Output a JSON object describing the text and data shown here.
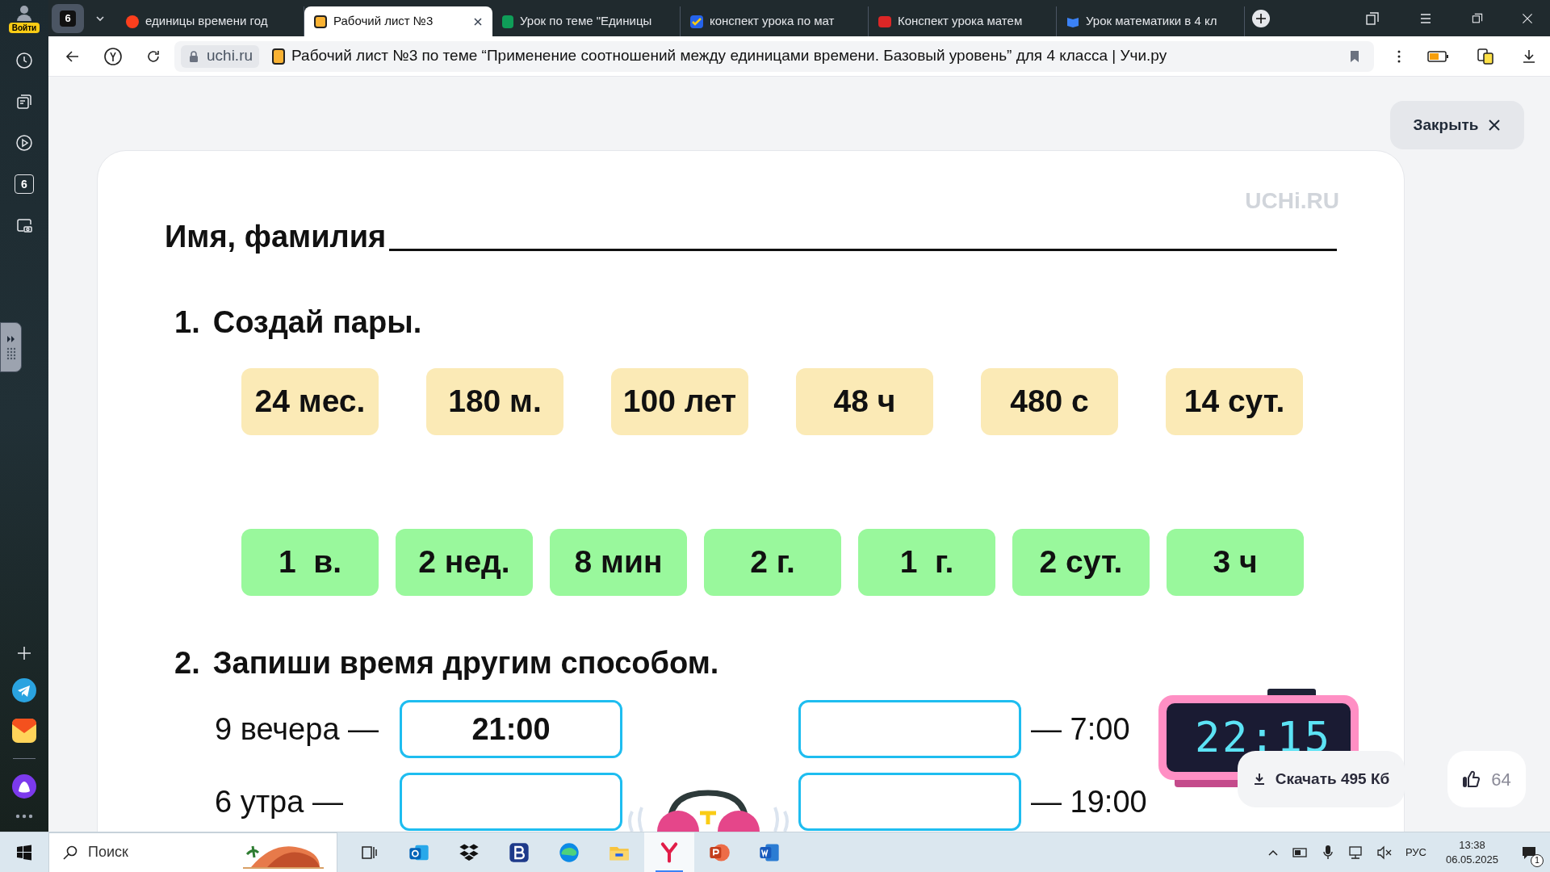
{
  "sidebar": {
    "login_label": "Войти",
    "counter": "6"
  },
  "tab_bar": {
    "tab_count": "6",
    "tabs": [
      {
        "kind": "yandex",
        "title": "единицы времени год",
        "selected": false
      },
      {
        "kind": "uchi",
        "title": "Рабочий лист №3",
        "selected": true
      },
      {
        "kind": "sheets",
        "title": "Урок по теме \"Единицы",
        "selected": false
      },
      {
        "kind": "check",
        "title": "конспект урока по мат",
        "selected": false
      },
      {
        "kind": "presentation",
        "title": "Конспект урока матем",
        "selected": false
      },
      {
        "kind": "book",
        "title": "Урок математики в 4 кл",
        "selected": false
      }
    ]
  },
  "address_bar": {
    "domain": "uchi.ru",
    "page_title": "Рабочий лист №3 по теме “Применение соотношений между единицами времени. Базовый уровень” для 4 класса | Учи.ру"
  },
  "close_button": "Закрыть",
  "worksheet": {
    "brand": "UCHi.RU",
    "name_label": "Имя, фамилия",
    "task1": {
      "number": "1.",
      "title": "Создай пары.",
      "top_cards": [
        "24 мес.",
        "180 м.",
        "100 лет",
        "48 ч",
        "480 с",
        "14 сут."
      ],
      "bottom_cards": [
        "1  в.",
        "2 нед.",
        "8 мин",
        "2 г.",
        "1  г.",
        "2 сут.",
        "3 ч"
      ]
    },
    "task2": {
      "number": "2.",
      "title": "Запиши время другим способом.",
      "rows": [
        {
          "left_label": "9 вечера —",
          "left_value": "21:00",
          "right_label": "— 7:00"
        },
        {
          "left_label": "6 утра —",
          "right_label": "— 19:00"
        }
      ]
    },
    "clock_display": "22:15"
  },
  "download_button": "Скачать 495 Кб",
  "likes": "64",
  "taskbar": {
    "search_placeholder": "Поиск",
    "apps": [
      {
        "kind": "taskview",
        "active": false
      },
      {
        "kind": "outlook",
        "active": false
      },
      {
        "kind": "dropbox",
        "active": false
      },
      {
        "kind": "b",
        "active": false
      },
      {
        "kind": "edge",
        "active": false
      },
      {
        "kind": "explorer",
        "active": false
      },
      {
        "kind": "yandex",
        "active": true
      },
      {
        "kind": "powerpoint",
        "active": false
      },
      {
        "kind": "word",
        "active": false
      }
    ],
    "language": "РУС",
    "time": "13:38",
    "date": "06.05.2025",
    "notifications": "1"
  }
}
